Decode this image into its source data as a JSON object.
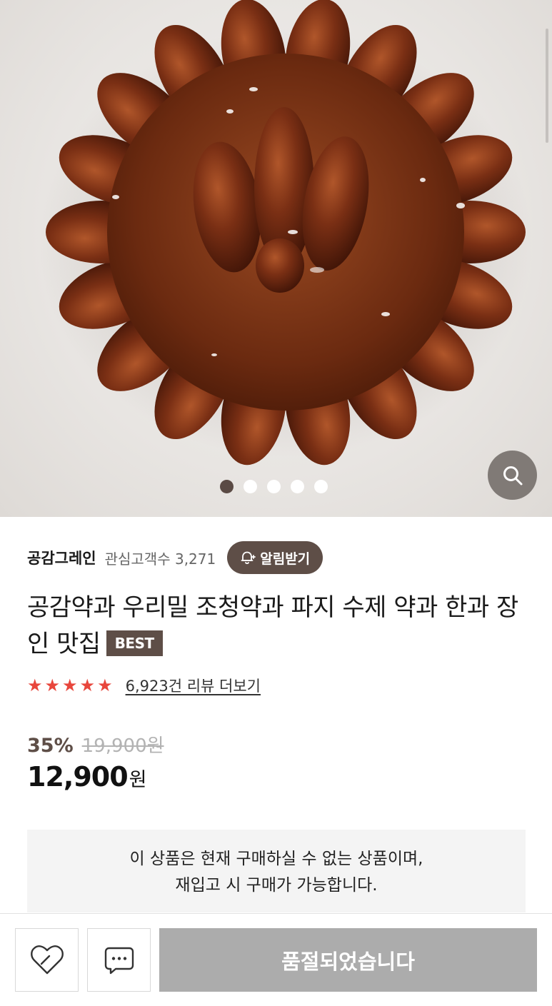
{
  "gallery": {
    "image_alt": "yakgwa",
    "slide_count": 5,
    "active_slide": 0,
    "zoom_icon": "search-icon"
  },
  "seller": {
    "name": "공감그레인",
    "watchers_label": "관심고객수 3,271",
    "alert_label": "알림받기",
    "alert_icon": "bell-plus-icon"
  },
  "product": {
    "title": "공감약과 우리밀 조청약과 파지 수제 약과 한과 장인 맛집",
    "badge": "BEST",
    "rating_stars": 5,
    "review_link": "6,923건 리뷰 더보기",
    "discount": "35%",
    "original_price": "19,900원",
    "sale_price": "12,900",
    "currency": "원"
  },
  "notice": {
    "line1": "이 상품은 현재 구매하실 수 없는 상품이며,",
    "line2": "재입고 시 구매가 가능합니다."
  },
  "bottom_bar": {
    "wish_icon": "heart-icon",
    "chat_icon": "chat-bubble-icon",
    "soldout_label": "품절되었습니다"
  },
  "colors": {
    "brand": "#5e4e47",
    "star": "#e8463c",
    "disabled_button": "#acacac"
  }
}
